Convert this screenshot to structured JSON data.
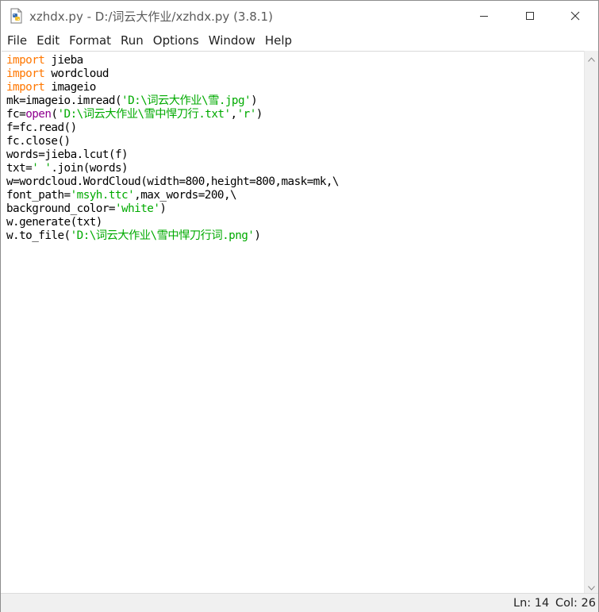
{
  "window": {
    "title": "xzhdx.py - D:/词云大作业/xzhdx.py (3.8.1)",
    "icon": "python-file-icon",
    "controls": [
      "minimize-icon",
      "maximize-icon",
      "close-icon"
    ]
  },
  "menu": {
    "items": [
      "File",
      "Edit",
      "Format",
      "Run",
      "Options",
      "Window",
      "Help"
    ]
  },
  "editor": {
    "syntax_colors": {
      "keyword": "#ff7700",
      "string": "#00aa00",
      "builtin": "#900090",
      "default": "#000000"
    },
    "lines": [
      [
        {
          "t": "import",
          "c": "kw"
        },
        {
          "t": " jieba",
          "c": ""
        }
      ],
      [
        {
          "t": "import",
          "c": "kw"
        },
        {
          "t": " wordcloud",
          "c": ""
        }
      ],
      [
        {
          "t": "import",
          "c": "kw"
        },
        {
          "t": " imageio",
          "c": ""
        }
      ],
      [
        {
          "t": "mk=imageio.imread(",
          "c": ""
        },
        {
          "t": "'D:\\词云大作业\\雪.jpg'",
          "c": "str"
        },
        {
          "t": ")",
          "c": ""
        }
      ],
      [
        {
          "t": "fc=",
          "c": ""
        },
        {
          "t": "open",
          "c": "bi"
        },
        {
          "t": "(",
          "c": ""
        },
        {
          "t": "'D:\\词云大作业\\雪中悍刀行.txt'",
          "c": "str"
        },
        {
          "t": ",",
          "c": ""
        },
        {
          "t": "'r'",
          "c": "str"
        },
        {
          "t": ")",
          "c": ""
        }
      ],
      [
        {
          "t": "f=fc.read()",
          "c": ""
        }
      ],
      [
        {
          "t": "fc.close()",
          "c": ""
        }
      ],
      [
        {
          "t": "words=jieba.lcut(f)",
          "c": ""
        }
      ],
      [
        {
          "t": "txt=",
          "c": ""
        },
        {
          "t": "' '",
          "c": "str"
        },
        {
          "t": ".join(words)",
          "c": ""
        }
      ],
      [
        {
          "t": "w=wordcloud.WordCloud(width=800,height=800,mask=mk,\\",
          "c": ""
        }
      ],
      [
        {
          "t": "font_path=",
          "c": ""
        },
        {
          "t": "'msyh.ttc'",
          "c": "str"
        },
        {
          "t": ",max_words=200,\\",
          "c": ""
        }
      ],
      [
        {
          "t": "background_color=",
          "c": ""
        },
        {
          "t": "'white'",
          "c": "str"
        },
        {
          "t": ")",
          "c": ""
        }
      ],
      [
        {
          "t": "w.generate(txt)",
          "c": ""
        }
      ],
      [
        {
          "t": "w.to_file(",
          "c": ""
        },
        {
          "t": "'D:\\词云大作业\\雪中悍刀行词.png'",
          "c": "str"
        },
        {
          "t": ")",
          "c": ""
        }
      ]
    ]
  },
  "scrollbar": {
    "up_icon": "scroll-up-arrow-icon",
    "down_icon": "scroll-down-arrow-icon"
  },
  "status": {
    "line": "Ln: 14",
    "column": "Col: 26"
  }
}
